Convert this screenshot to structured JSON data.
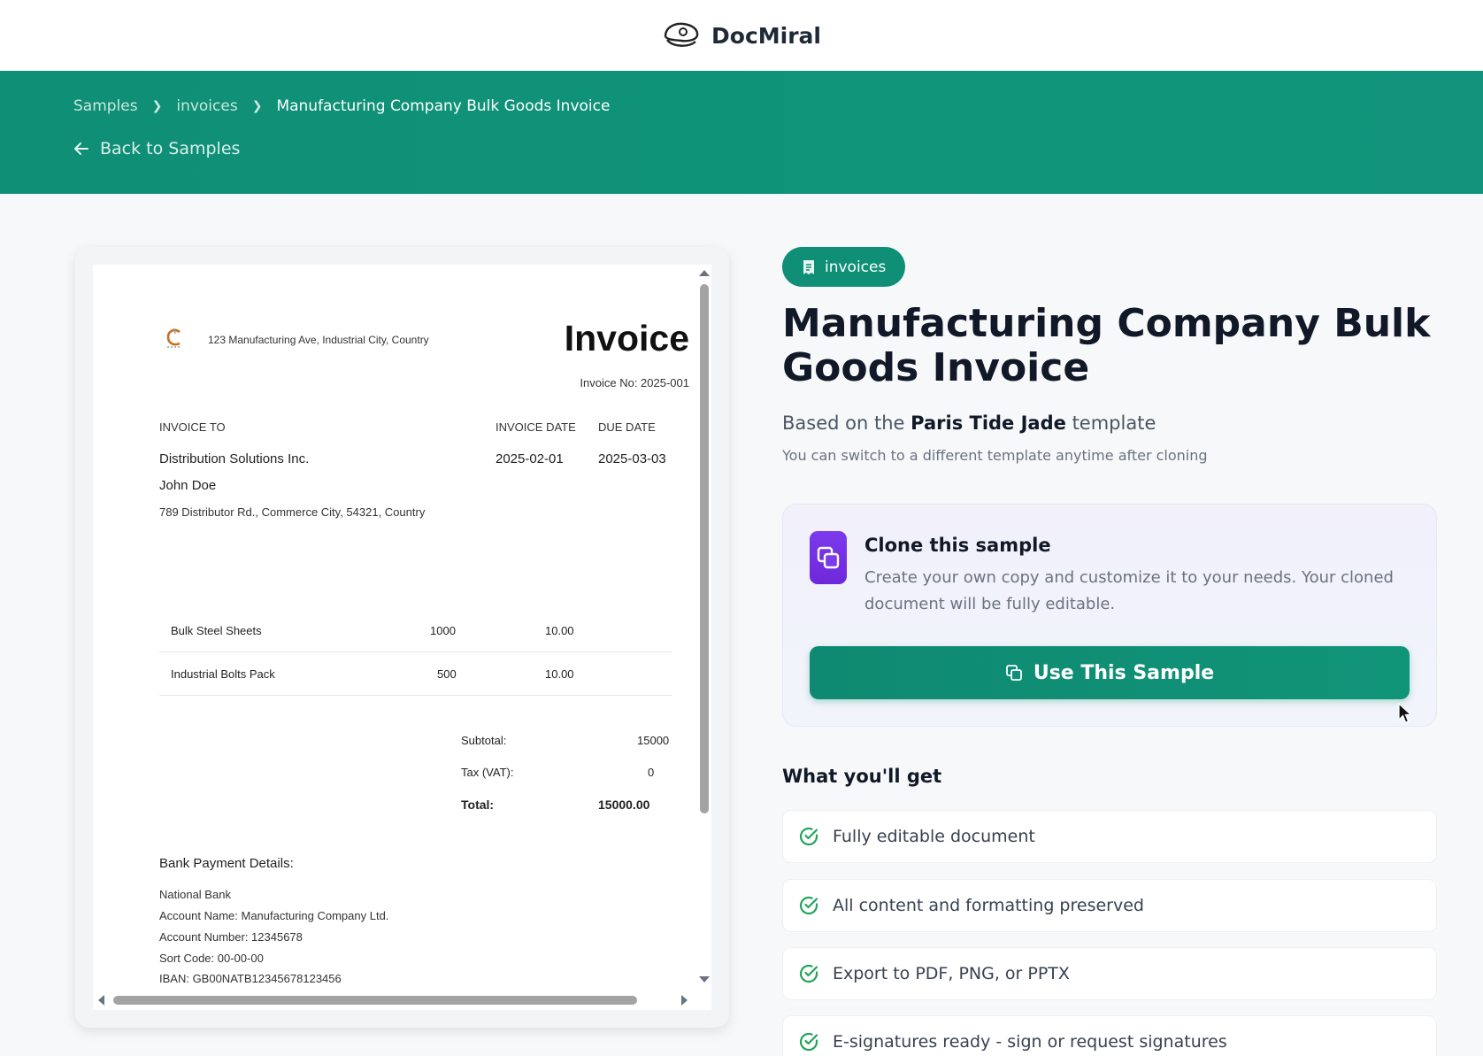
{
  "brand": {
    "name": "DocMiral",
    "logo_icon": "captain-hat-icon"
  },
  "breadcrumb": {
    "items": [
      "Samples",
      "invoices",
      "Manufacturing Company Bulk Goods Invoice"
    ]
  },
  "back_link": {
    "label": "Back to Samples"
  },
  "category_chip": {
    "label": "invoices"
  },
  "sample": {
    "title": "Manufacturing Company Bulk Goods Invoice",
    "based_prefix": "Based on the",
    "template_name": "Paris Tide Jade",
    "based_suffix": "template",
    "switch_note": "You can switch to a different template anytime after cloning"
  },
  "clone": {
    "title": "Clone this sample",
    "description": "Create your own copy and customize it to your needs. Your cloned document will be fully editable.",
    "button_label": "Use This Sample"
  },
  "features": {
    "heading": "What you'll get",
    "items": [
      "Fully editable document",
      "All content and formatting preserved",
      "Export to PDF, PNG, or PPTX",
      "E-signatures ready - sign or request signatures"
    ]
  },
  "invoice": {
    "company_address": "123 Manufacturing Ave, Industrial City, Country",
    "title": "Invoice",
    "number": "Invoice No: 2025-001",
    "invoice_to_label": "INVOICE TO",
    "invoice_date_label": "INVOICE DATE",
    "due_date_label": "DUE DATE",
    "client_company": "Distribution Solutions Inc.",
    "client_contact": "John Doe",
    "client_address": "789 Distributor Rd., Commerce City, 54321, Country",
    "invoice_date": "2025-02-01",
    "due_date": "2025-03-03",
    "line_items": [
      {
        "description": "Bulk Steel Sheets",
        "qty": "1000",
        "price": "10.00"
      },
      {
        "description": "Industrial Bolts Pack",
        "qty": "500",
        "price": "10.00"
      }
    ],
    "subtotal_label": "Subtotal:",
    "subtotal": "15000",
    "tax_label": "Tax (VAT):",
    "tax": "0",
    "total_label": "Total:",
    "total": "15000.00",
    "bank_heading": "Bank Payment Details:",
    "bank_lines": [
      "National Bank",
      "Account Name: Manufacturing Company Ltd.",
      "Account Number: 12345678",
      "Sort Code: 00-00-00",
      "IBAN: GB00NATB12345678123456"
    ]
  },
  "colors": {
    "accent": "#0f8f76",
    "clone_icon": "#7c3aed",
    "check": "#22a35a"
  }
}
